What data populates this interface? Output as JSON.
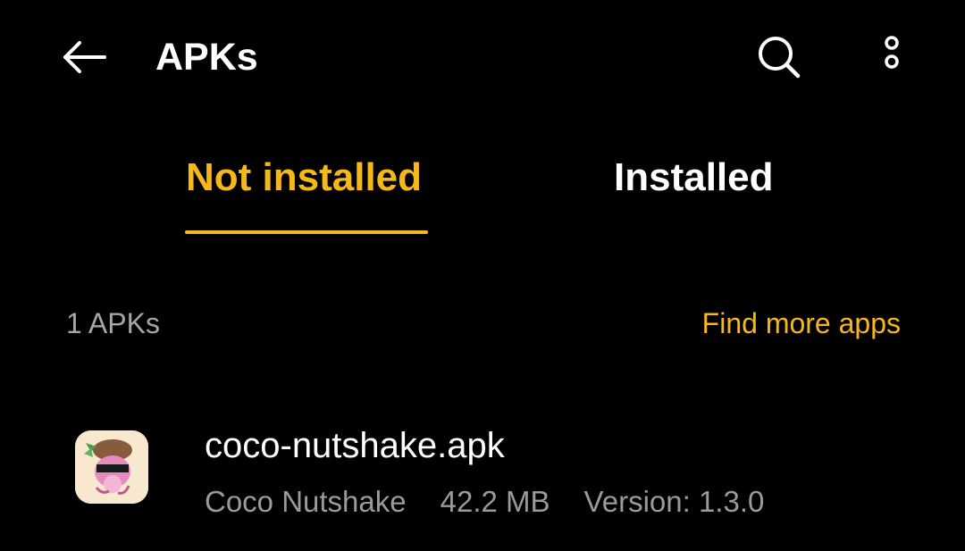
{
  "header": {
    "title": "APKs",
    "back_icon": "arrow-left-icon",
    "search_icon": "search-icon",
    "more_icon": "more-vertical-icon"
  },
  "tabs": [
    {
      "label": "Not installed",
      "selected": true
    },
    {
      "label": "Installed",
      "selected": false
    }
  ],
  "list_header": {
    "count_label": "1 APKs",
    "find_more_label": "Find more apps"
  },
  "apks": [
    {
      "file_name": "coco-nutshake.apk",
      "app_name": "Coco Nutshake",
      "size": "42.2 MB",
      "version": "Version: 1.3.0",
      "icon": "coco-nutshake-app-icon"
    }
  ],
  "colors": {
    "background": "#000000",
    "accent": "#f5b818",
    "text_primary": "#ffffff",
    "text_secondary": "#9a9a9a"
  }
}
